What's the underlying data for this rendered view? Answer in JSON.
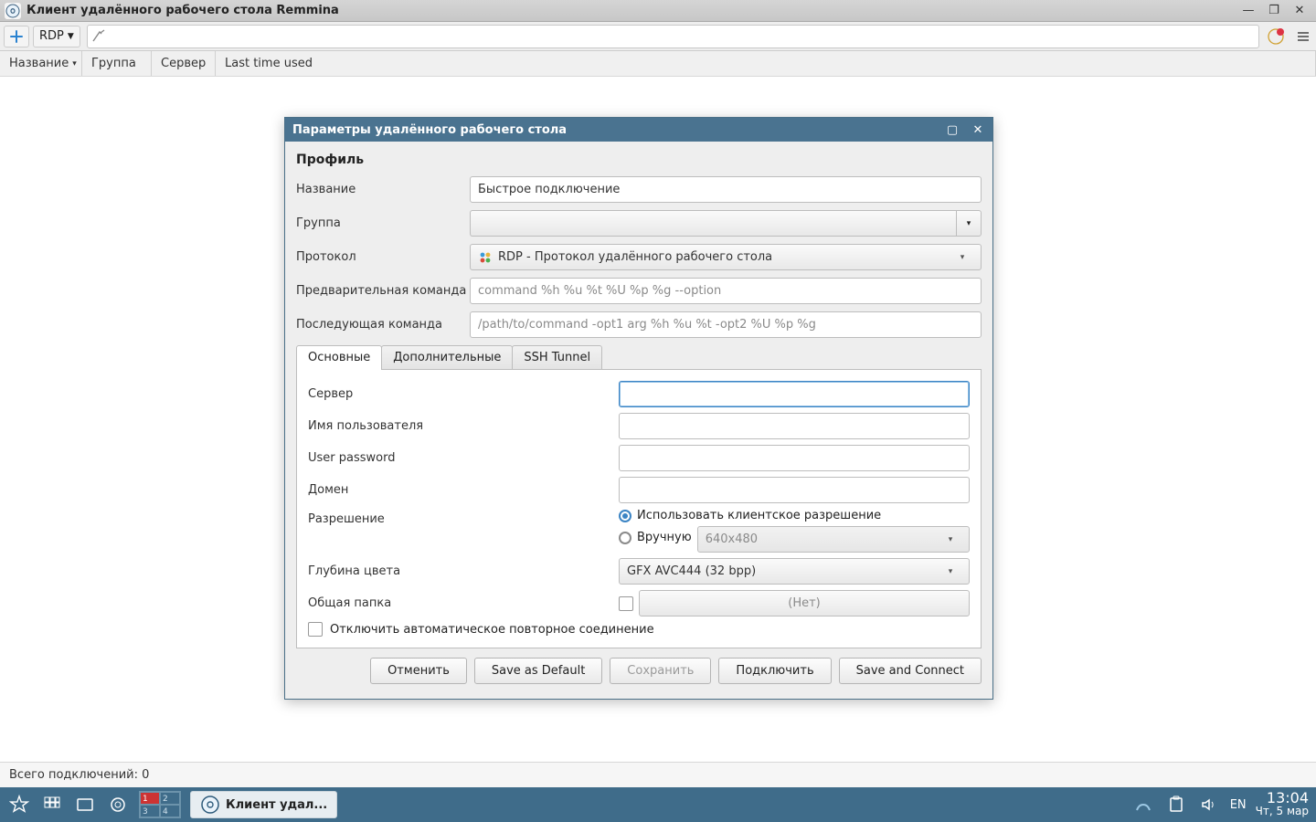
{
  "window": {
    "title": "Клиент удалённого рабочего стола Remmina"
  },
  "toolbar": {
    "quick_protocol": "RDP"
  },
  "columns": {
    "name": "Название",
    "group": "Группа",
    "server": "Сервер",
    "last": "Last time used"
  },
  "status": {
    "total": "Всего подключений: 0"
  },
  "dialog": {
    "title": "Параметры удалённого рабочего стола",
    "profile_heading": "Профиль",
    "labels": {
      "name": "Название",
      "group": "Группа",
      "protocol": "Протокол",
      "pre_cmd": "Предварительная команда",
      "post_cmd": "Последующая команда"
    },
    "values": {
      "name": "Быстрое подключение",
      "protocol": "RDP - Протокол удалённого рабочего стола"
    },
    "placeholders": {
      "pre_cmd": "command %h %u %t %U %p %g --option",
      "post_cmd": "/path/to/command -opt1 arg %h %u %t -opt2 %U %p %g",
      "resolution": "640x480"
    },
    "tabs": {
      "basic": "Основные",
      "advanced": "Дополнительные",
      "ssh": "SSH Tunnel"
    },
    "basic": {
      "server": "Сервер",
      "username": "Имя пользователя",
      "password": "User password",
      "domain": "Домен",
      "resolution": "Разрешение",
      "resolution_client": "Использовать клиентское разрешение",
      "resolution_manual": "Вручную",
      "color_depth": "Глубина цвета",
      "color_depth_value": "GFX AVC444 (32 bpp)",
      "shared_folder": "Общая папка",
      "shared_folder_none": "(Нет)",
      "disable_reconnect": "Отключить автоматическое повторное соединение"
    },
    "buttons": {
      "cancel": "Отменить",
      "save_default": "Save as Default",
      "save": "Сохранить",
      "connect": "Подключить",
      "save_connect": "Save and Connect"
    }
  },
  "taskbar": {
    "app_label": "Клиент удал...",
    "lang": "EN",
    "time": "13:04",
    "date": "Чт,  5 мар",
    "pager": [
      "1",
      "2",
      "3",
      "4"
    ]
  }
}
